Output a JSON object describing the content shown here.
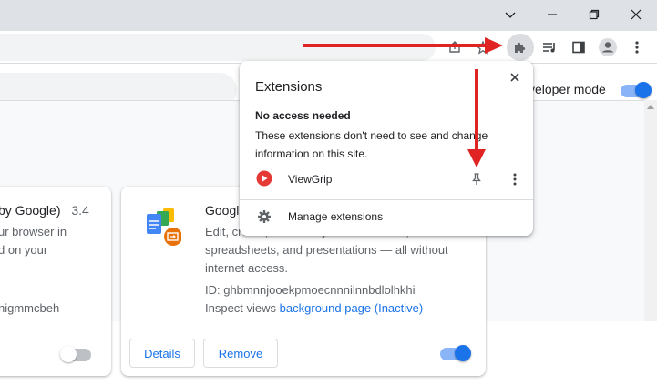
{
  "window": {
    "icons": [
      "chevron-down-icon",
      "minimize-icon",
      "restore-icon",
      "close-icon"
    ]
  },
  "toolbar": {
    "icons": [
      "share-icon",
      "bookmark-icon",
      "extensions-puzzle-icon",
      "media-control-icon",
      "side-panel-icon",
      "profile-avatar-icon",
      "more-menu-icon"
    ]
  },
  "page": {
    "developer_mode_label": "Developer mode",
    "developer_mode_label_visible": "veloper mode",
    "developer_mode_on": true
  },
  "cards": [
    {
      "title_fragment": "by Google)",
      "version": "3.4",
      "desc_lines": [
        "ur browser in",
        "d on your"
      ],
      "id_fragment": "higmmcbeh",
      "enabled": false
    },
    {
      "title_fragment": "Google",
      "desc_lines": [
        "Edit, create, and view your documents,",
        "spreadsheets, and presentations — all without",
        "internet access."
      ],
      "id_label": "ID: ghbmnnjooekpmoecnnnilnnbdlolhkhi",
      "inspect_label": "Inspect views",
      "inspect_link": "background page (Inactive)",
      "details_label": "Details",
      "remove_label": "Remove",
      "enabled": true
    }
  ],
  "popup": {
    "title": "Extensions",
    "section_heading": "No access needed",
    "section_desc": "These extensions don't need to see and change information on this site.",
    "extension_name": "ViewGrip",
    "manage_label": "Manage extensions"
  },
  "colors": {
    "arrow": "#e02424",
    "accent": "#1a73e8",
    "viewgrip_red": "#e53935"
  }
}
